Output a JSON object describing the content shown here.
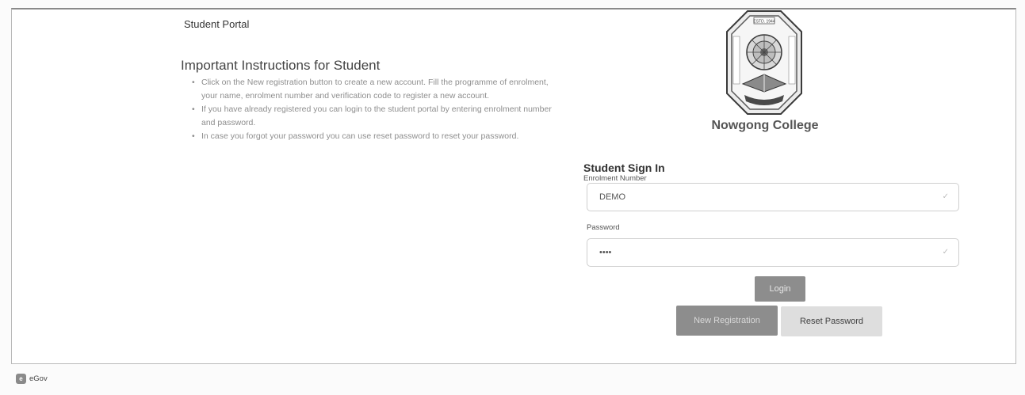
{
  "header": {
    "portal_title": "Student Portal"
  },
  "instructions": {
    "heading": "Important Instructions for Student",
    "items": [
      "Click on the New registration button to create a new account. Fill the programme of enrolment, your name, enrolment number and verification code to register a new account.",
      "If you have already registered you can login to the student portal by entering enrolment number and password.",
      "In case you forgot your password you can use reset password to reset your password."
    ]
  },
  "college": {
    "name": "Nowgong College",
    "logo_text": "ESTD. 1944"
  },
  "signin": {
    "title": "Student Sign In",
    "enrolment_label": "Enrolment Number",
    "enrolment_value": "DEMO",
    "password_label": "Password",
    "password_value": "demo"
  },
  "buttons": {
    "login": "Login",
    "new_registration": "New Registration",
    "reset_password": "Reset Password"
  },
  "footer": {
    "brand": "eGov",
    "brand_icon": "e"
  },
  "icons": {
    "valid_check": "✓"
  },
  "colors": {
    "primary_button": "#8d8d8d",
    "secondary_button": "#dedede"
  }
}
